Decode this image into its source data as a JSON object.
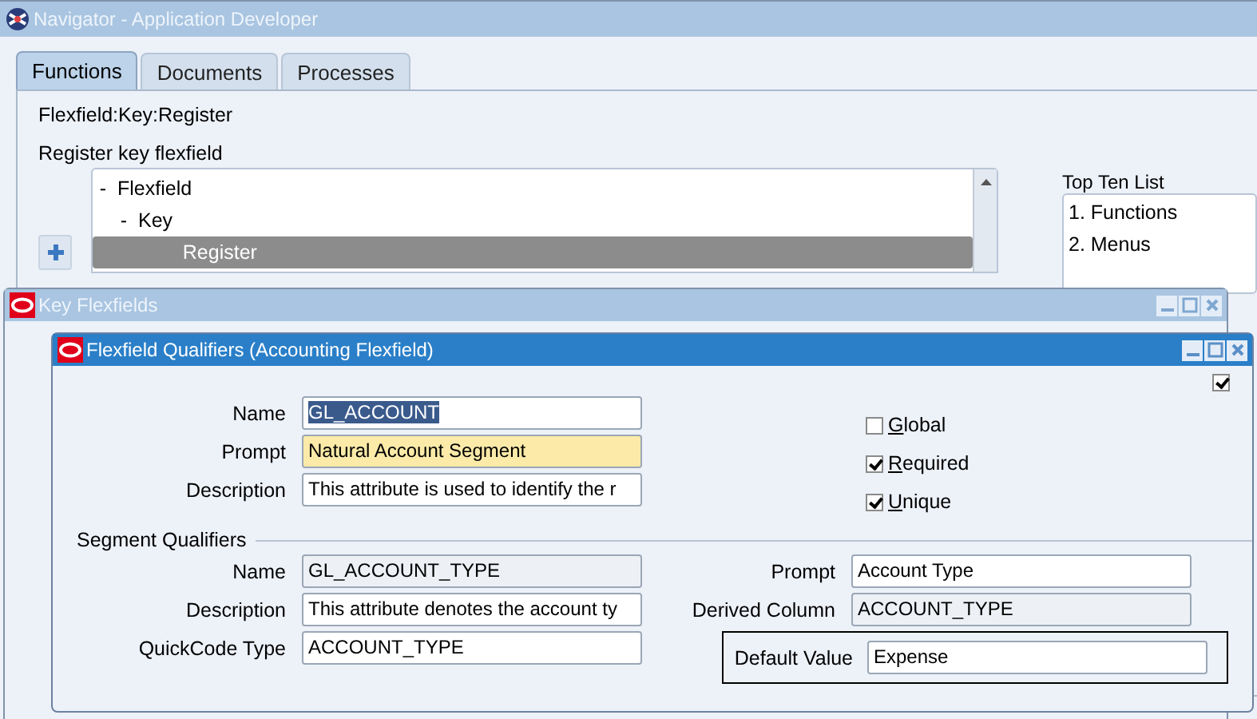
{
  "navigator": {
    "title": "Navigator - Application Developer",
    "tabs": [
      {
        "label": "Functions",
        "selected": true
      },
      {
        "label": "Documents",
        "selected": false
      },
      {
        "label": "Processes",
        "selected": false
      }
    ],
    "function_name": "Flexfield:Key:Register",
    "function_description": "Register key flexfield",
    "tree": [
      {
        "toggle": "-",
        "label": "Flexfield",
        "selected": false,
        "children": [
          {
            "toggle": "-",
            "label": "Key",
            "selected": false,
            "children": [
              {
                "label": "Register",
                "selected": true
              }
            ]
          }
        ]
      }
    ],
    "top_ten": {
      "title": "Top Ten List",
      "items": [
        "1. Functions",
        "2. Menus"
      ]
    }
  },
  "key_window": {
    "title": "Key Flexfields"
  },
  "qualifiers_window": {
    "title": "Flexfield Qualifiers (Accounting Flexfield)",
    "record_checked": true,
    "fields": [
      {
        "label": "Name",
        "value": "GL_ACCOUNT",
        "kind": "selected"
      },
      {
        "label": "Prompt",
        "value": "Natural Account Segment",
        "kind": "required"
      },
      {
        "label": "Description",
        "value": "This attribute is used to identify the r",
        "kind": "text"
      }
    ],
    "checkboxes": [
      {
        "label": "Global",
        "checked": false
      },
      {
        "label": "Required",
        "checked": true
      },
      {
        "label": "Unique",
        "checked": true
      }
    ],
    "segment_qualifiers": {
      "title": "Segment Qualifiers",
      "left_fields": [
        {
          "label": "Name",
          "value": "GL_ACCOUNT_TYPE",
          "kind": "readonly"
        },
        {
          "label": "Description",
          "value": "This attribute denotes the account ty",
          "kind": "text"
        },
        {
          "label": "QuickCode Type",
          "value": "ACCOUNT_TYPE",
          "kind": "text"
        }
      ],
      "right_fields": [
        {
          "label": "Prompt",
          "value": "Account Type",
          "kind": "text",
          "highlighted": false
        },
        {
          "label": "Derived Column",
          "value": "ACCOUNT_TYPE",
          "kind": "readonly",
          "highlighted": false
        },
        {
          "label": "Default Value",
          "value": "Expense",
          "kind": "text",
          "highlighted": true
        }
      ]
    }
  }
}
